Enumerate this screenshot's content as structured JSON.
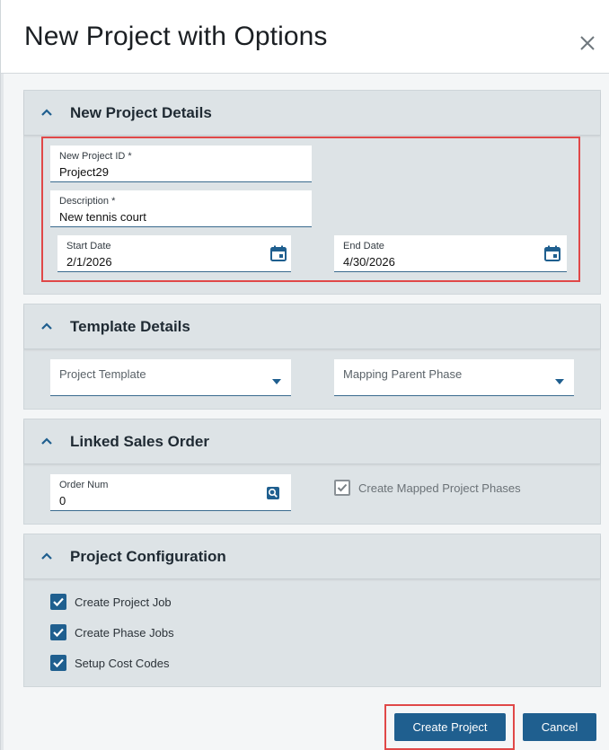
{
  "dialog": {
    "title": "New Project with Options",
    "close_icon": "close-icon"
  },
  "sections": {
    "details": {
      "title": "New Project Details",
      "project_id": {
        "label": "New Project ID *",
        "value": "Project29"
      },
      "description": {
        "label": "Description *",
        "value": "New tennis court"
      },
      "start_date": {
        "label": "Start Date",
        "value": "2/1/2026",
        "icon": "calendar-icon"
      },
      "end_date": {
        "label": "End Date",
        "value": "4/30/2026",
        "icon": "calendar-icon"
      }
    },
    "template": {
      "title": "Template Details",
      "project_template": {
        "placeholder": "Project Template",
        "value": ""
      },
      "mapping_parent_phase": {
        "placeholder": "Mapping Parent Phase",
        "value": ""
      }
    },
    "linked": {
      "title": "Linked Sales Order",
      "order_num": {
        "label": "Order Num",
        "value": "0",
        "icon": "search-icon"
      },
      "create_mapped_phases": {
        "label": "Create Mapped Project Phases",
        "checked": true,
        "enabled": false
      }
    },
    "config": {
      "title": "Project Configuration",
      "options": [
        {
          "label": "Create Project Job",
          "checked": true
        },
        {
          "label": "Create Phase Jobs",
          "checked": true
        },
        {
          "label": "Setup Cost Codes",
          "checked": true
        }
      ]
    }
  },
  "footer": {
    "create_label": "Create Project",
    "cancel_label": "Cancel"
  },
  "colors": {
    "accent": "#1f5f8f",
    "highlight": "#e04848",
    "section_bg": "#dde3e6"
  }
}
